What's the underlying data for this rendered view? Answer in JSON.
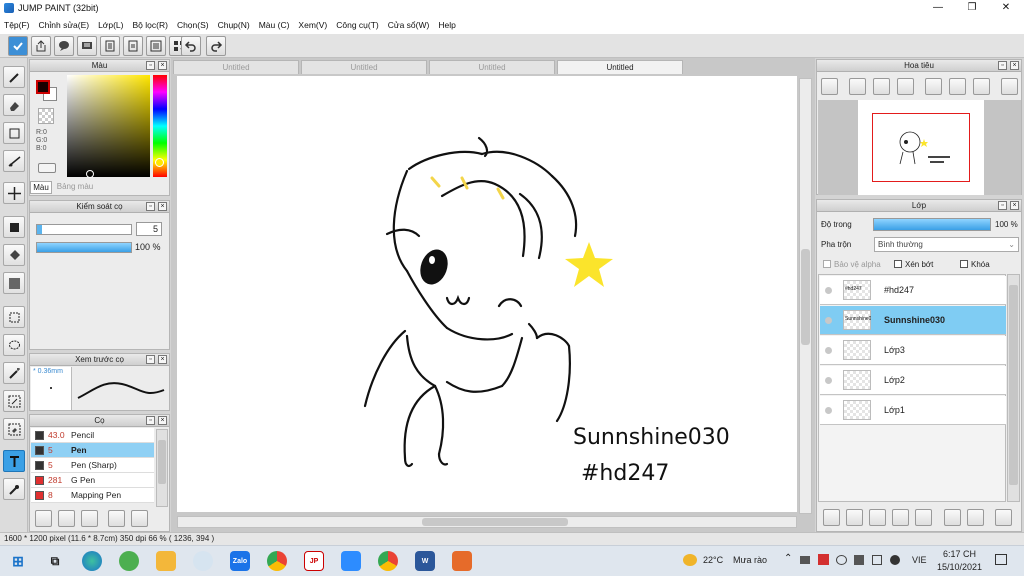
{
  "window": {
    "title": "JUMP PAINT (32bit)",
    "minimize": "—",
    "maximize": "❐",
    "close": "✕"
  },
  "menu": [
    "Tệp(F)",
    "Chỉnh sửa(E)",
    "Lớp(L)",
    "Bộ lọc(R)",
    "Chọn(S)",
    "Chụp(N)",
    "Màu (C)",
    "Xem(V)",
    "Công cụ(T)",
    "Cửa sổ(W)",
    "Help"
  ],
  "tabs": [
    "Untitled",
    "Untitled",
    "Untitled",
    "Untitled"
  ],
  "color_panel": {
    "title": "Màu",
    "r_label": "R:0",
    "g_label": "G:0",
    "b_label": "B:0",
    "tab_color": "Màu",
    "tab_palette": "Bảng màu",
    "foreground": "#1a0000",
    "background": "#ffffff"
  },
  "brush_control": {
    "title": "Kiểm soát cọ",
    "size_value": "5",
    "opacity_value": "100 %",
    "opacity_fraction": 1.0
  },
  "brush_preview": {
    "title": "Xem trước cọ",
    "size_label": "* 0.36mm"
  },
  "brush_list": {
    "title": "Cọ",
    "items": [
      {
        "size": "43.0",
        "name": "Pencil",
        "color": "#333333"
      },
      {
        "size": "5",
        "name": "Pen",
        "color": "#333333"
      },
      {
        "size": "5",
        "name": "Pen (Sharp)",
        "color": "#333333"
      },
      {
        "size": "281",
        "name": "G Pen",
        "color": "#e03030"
      },
      {
        "size": "8",
        "name": "Mapping Pen",
        "color": "#e03030"
      }
    ],
    "selected_index": 1
  },
  "navigator": {
    "title": "Hoa tiêu"
  },
  "layers": {
    "title": "Lớp",
    "opacity_label": "Độ trong",
    "opacity_value": "100 %",
    "opacity_fraction": 1.0,
    "blend_label": "Pha trộn",
    "blend_value": "Bình thường",
    "protect_alpha": "Bảo vệ alpha",
    "clipping": "Xén bớt",
    "lock": "Khóa",
    "items": [
      {
        "name": "#hd247",
        "thumb_text": "#hd247"
      },
      {
        "name": "Sunnshine030",
        "thumb_text": "Sunnshine030"
      },
      {
        "name": "Lớp3",
        "thumb_text": ""
      },
      {
        "name": "Lớp2",
        "thumb_text": ""
      },
      {
        "name": "Lớp1",
        "thumb_text": ""
      }
    ],
    "selected_index": 1
  },
  "canvas": {
    "line1": "Sunnshine030",
    "line2": "#hd247"
  },
  "status": {
    "text": "1600 * 1200 pixel   (11.6 * 8.7cm)   350 dpi   66 %   ( 1236, 394 )"
  },
  "taskbar": {
    "weather_temp": "22°C",
    "weather_text": "Mưa rào",
    "lang": "VIE",
    "time": "6:17 CH",
    "date": "15/10/2021",
    "apps": [
      "start",
      "search",
      "task-view",
      "edge",
      "app",
      "app",
      "explorer",
      "app",
      "zalo",
      "chrome",
      "jump-paint",
      "zoom",
      "chrome",
      "word",
      "app"
    ]
  }
}
